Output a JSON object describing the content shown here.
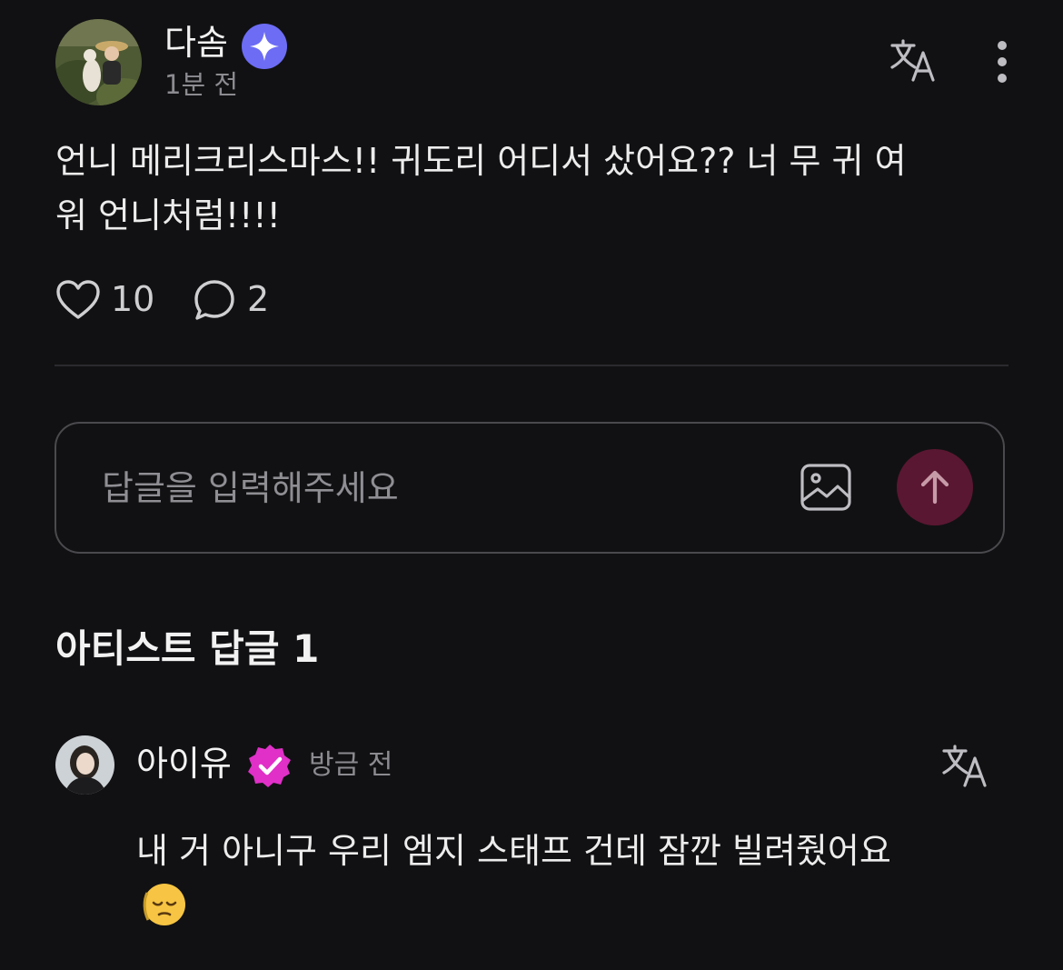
{
  "post": {
    "author": "다솜",
    "time": "1분 전",
    "body": "언니 메리크리스마스!! 귀도리 어디서 샀어요?? 너 무 귀 여\n워 언니처럼!!!!",
    "likes": "10",
    "comments": "2"
  },
  "reply_input": {
    "placeholder": "답글을 입력해주세요"
  },
  "artist_section": {
    "title": "아티스트 답글 1"
  },
  "artist_reply": {
    "author": "아이유",
    "time": "방금 전",
    "text": "내 거 아니구 우리 엠지 스태프 건데 잠깐 빌려줬어요"
  },
  "icons": {
    "verified_blue": "sparkle-badge-icon",
    "verified_pink": "check-badge-icon",
    "translate": "translate-icon",
    "more": "more-vertical-icon",
    "like": "heart-outline-icon",
    "comment": "chat-bubble-icon",
    "image": "image-icon",
    "send": "arrow-up-icon",
    "emoji": "pensive-face-emoji"
  },
  "colors": {
    "background": "#111113",
    "blue_badge": "#6c6cf5",
    "pink_badge": "#e030c8",
    "send_button": "#5a1731"
  }
}
